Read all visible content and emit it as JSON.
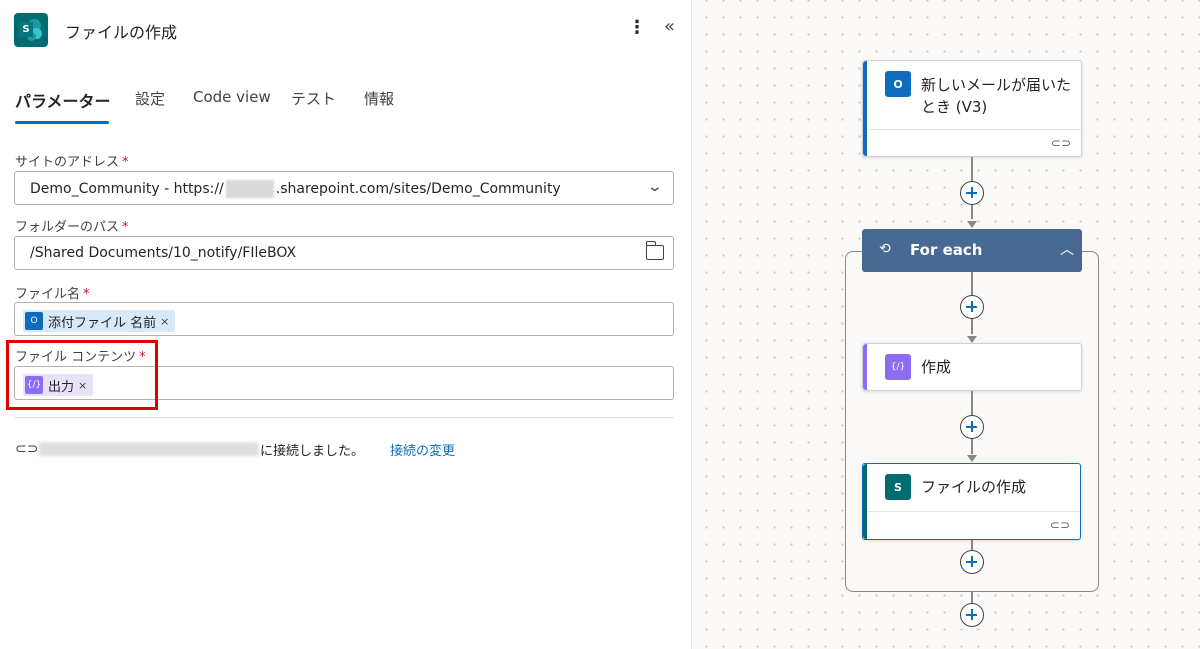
{
  "panel": {
    "title": "ファイルの作成",
    "more_icon": "⋮",
    "collapse_icon": "«",
    "tabs": [
      "パラメーター",
      "設定",
      "Code view",
      "テスト",
      "情報"
    ],
    "fields": {
      "site_address": {
        "label": "サイトのアドレス",
        "value_prefix": "Demo_Community - https://",
        "value_suffix": ".sharepoint.com/sites/Demo_Community"
      },
      "folder_path": {
        "label": "フォルダーのパス",
        "value": "/Shared Documents/10_notify/FIleBOX"
      },
      "file_name": {
        "label": "ファイル名",
        "token": "添付ファイル 名前"
      },
      "file_content": {
        "label": "ファイル コンテンツ",
        "token": "出力"
      },
      "required_mark": "*",
      "token_remove": "×"
    },
    "connection": {
      "text": "に接続しました。",
      "change_link": "接続の変更"
    }
  },
  "canvas": {
    "trigger": {
      "title": "新しいメールが届いたとき (V3)"
    },
    "foreach": {
      "label": "For each"
    },
    "compose": {
      "title": "作成"
    },
    "create_file": {
      "title": "ファイルの作成"
    }
  },
  "colors": {
    "accent": "#0f6cbd",
    "sharepoint": "#036c70",
    "outlook": "#0f6cbd",
    "compose": "#8c6cf0",
    "foreach": "#486991",
    "highlight": "#e00000"
  }
}
